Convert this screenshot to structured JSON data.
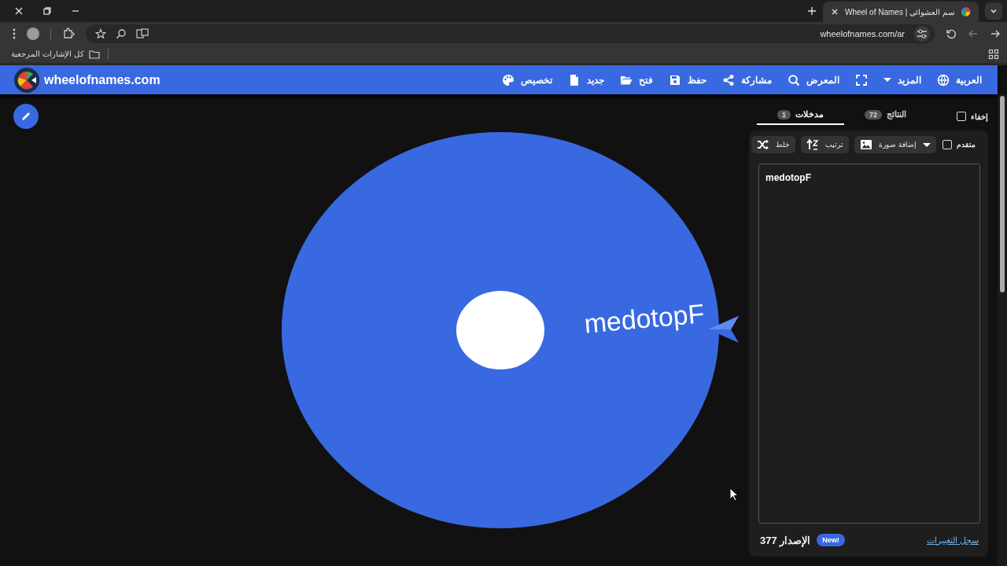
{
  "browser": {
    "tab_title": "سم العشوائي | Wheel of Names",
    "url": "wheelofnames.com/ar",
    "bookmarks_label": "كل الإشارات المرجعية"
  },
  "header": {
    "logo_text": "wheelofnames.com",
    "nav": [
      {
        "kind": "globe",
        "label": "العربية"
      },
      {
        "kind": "caret",
        "label": "المزيد"
      },
      {
        "kind": "fullscreen"
      },
      {
        "kind": "search",
        "label": "المعرض"
      },
      {
        "kind": "share",
        "label": "مشاركة"
      },
      {
        "kind": "save",
        "label": "حفظ"
      },
      {
        "kind": "folder",
        "label": "فتح"
      },
      {
        "kind": "file",
        "label": "جديد"
      },
      {
        "kind": "palette",
        "label": "تخصيص"
      }
    ]
  },
  "wheel": {
    "segments": [
      {
        "label": "medotopF",
        "color": "#3869e0"
      }
    ]
  },
  "panel": {
    "hide": {
      "label": "إخفاء",
      "checked": false
    },
    "tabs": [
      {
        "label": "النتائج",
        "count": "72",
        "selected": false
      },
      {
        "label": "مدخلات",
        "count": "1",
        "selected": true
      }
    ],
    "advanced": {
      "label": "متقدم",
      "checked": false
    },
    "tools": [
      {
        "kind": "image",
        "label": "إضافة صورة"
      },
      {
        "kind": "sort",
        "label": "ترتيب"
      },
      {
        "kind": "shuffle",
        "label": "خلط"
      }
    ],
    "entries": "medotopF",
    "version": "الإصدار 377",
    "new_badge": "New!",
    "changelog": "سجل التغييرات"
  }
}
